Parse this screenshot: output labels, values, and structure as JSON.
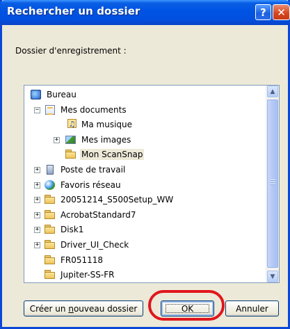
{
  "window": {
    "title": "Rechercher un dossier",
    "help_glyph": "?",
    "close_glyph": "✕"
  },
  "dialog": {
    "destination_label": "Dossier d'enregistrement :"
  },
  "tree": {
    "items": [
      {
        "label": "Bureau",
        "icon": "desktop-icon",
        "expander": ""
      },
      {
        "label": "Mes documents",
        "icon": "my-documents-icon",
        "expander": "−"
      },
      {
        "label": "Ma musique",
        "icon": "music-folder-icon",
        "expander": ""
      },
      {
        "label": "Mes images",
        "icon": "pictures-folder-icon",
        "expander": "+"
      },
      {
        "label": "Mon ScanSnap",
        "icon": "folder-icon",
        "expander": "",
        "selected": true
      },
      {
        "label": "Poste de travail",
        "icon": "computer-icon",
        "expander": "+"
      },
      {
        "label": "Favoris réseau",
        "icon": "network-icon",
        "expander": "+"
      },
      {
        "label": "20051214_S500Setup_WW",
        "icon": "folder-icon",
        "expander": "+"
      },
      {
        "label": "AcrobatStandard7",
        "icon": "folder-icon",
        "expander": "+"
      },
      {
        "label": "Disk1",
        "icon": "folder-icon",
        "expander": "+"
      },
      {
        "label": "Driver_UI_Check",
        "icon": "folder-icon",
        "expander": "+"
      },
      {
        "label": "FR051118",
        "icon": "folder-icon",
        "expander": ""
      },
      {
        "label": "Jupiter-SS-FR",
        "icon": "folder-icon",
        "expander": ""
      }
    ]
  },
  "buttons": {
    "new_folder_prefix": "Créer un ",
    "new_folder_mnemonic": "n",
    "new_folder_suffix": "ouveau dossier",
    "ok": "OK",
    "cancel": "Annuler"
  },
  "colors": {
    "highlight_circle": "#e0161c",
    "titlebar": "#0054e3"
  }
}
